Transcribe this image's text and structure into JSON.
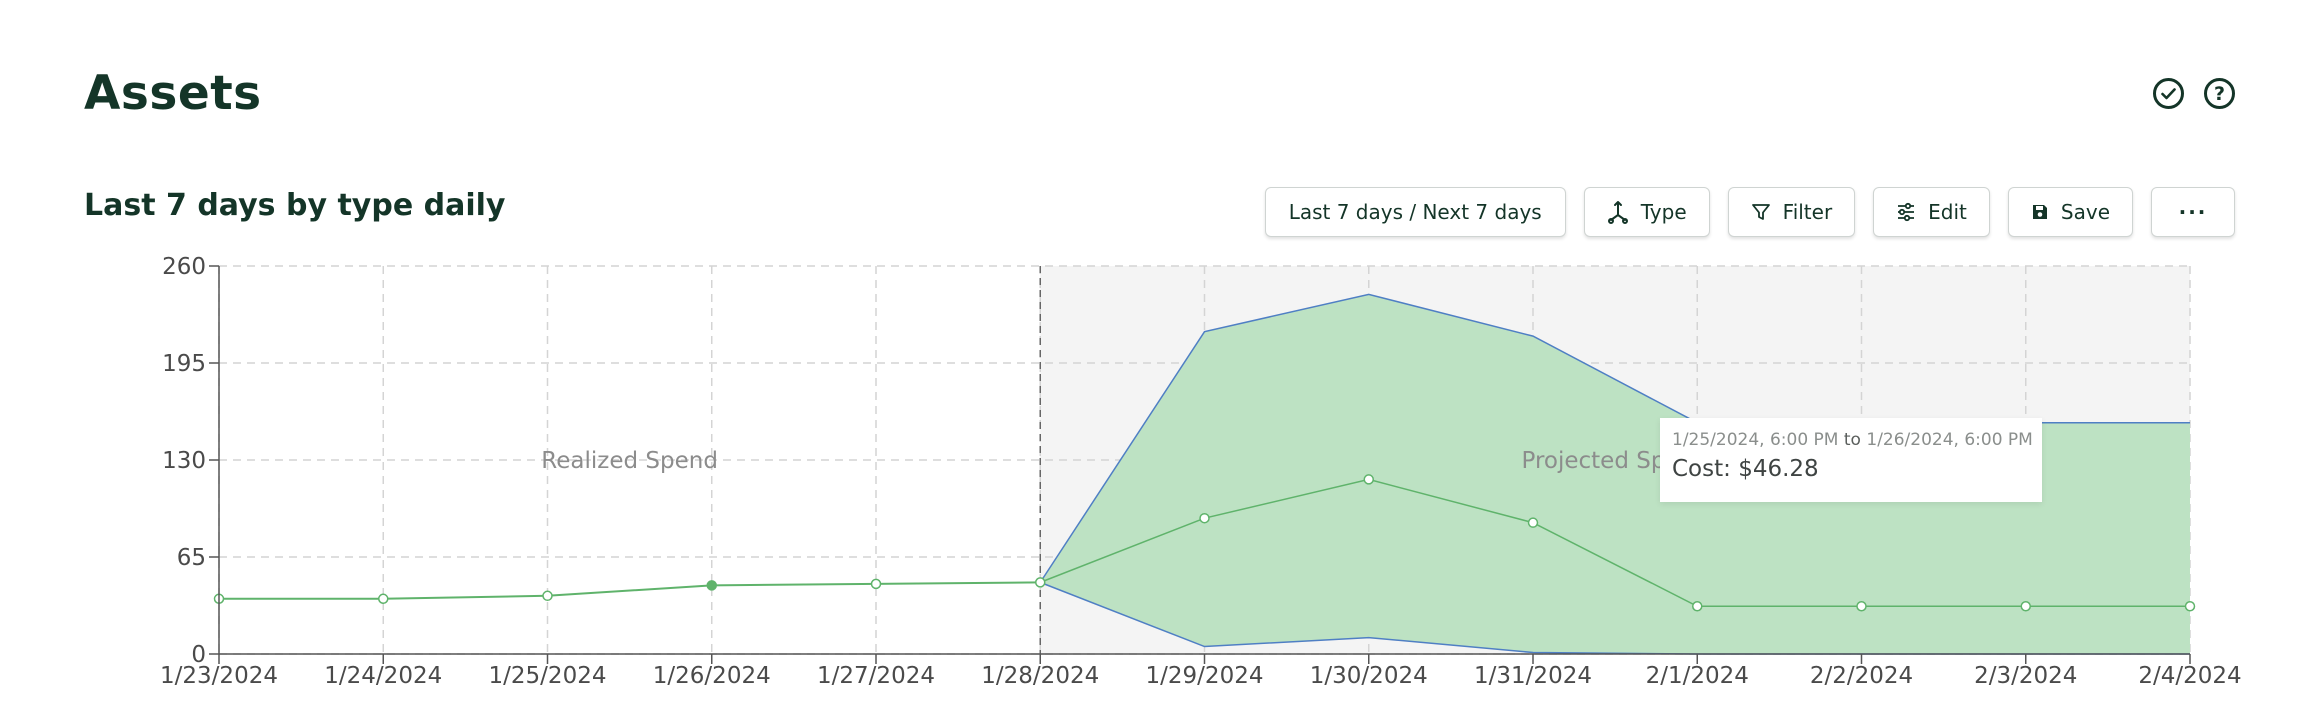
{
  "page": {
    "title": "Assets"
  },
  "header_icons": [
    {
      "name": "check-circle-icon"
    },
    {
      "name": "help-circle-icon",
      "glyph": "?"
    }
  ],
  "chart_title": "Last 7 days by type daily",
  "toolbar": {
    "range_label": "Last 7 days / Next 7 days",
    "type_label": "Type",
    "filter_label": "Filter",
    "edit_label": "Edit",
    "save_label": "Save",
    "more_label": "···"
  },
  "tooltip": {
    "range_start": "1/25/2024, 6:00 PM",
    "range_sep": "to",
    "range_end": "1/26/2024, 6:00 PM",
    "cost_label": "Cost:",
    "cost_value": "$46.28"
  },
  "chart_data": {
    "type": "line",
    "title": "Last 7 days by type daily",
    "xlabel": "",
    "ylabel": "",
    "categories": [
      "1/23/2024",
      "1/24/2024",
      "1/25/2024",
      "1/26/2024",
      "1/27/2024",
      "1/28/2024",
      "1/29/2024",
      "1/30/2024",
      "1/31/2024",
      "2/1/2024",
      "2/2/2024",
      "2/3/2024",
      "2/4/2024"
    ],
    "ylim": [
      0,
      260
    ],
    "yticks": [
      0,
      65,
      130,
      195,
      260
    ],
    "grid": true,
    "realized": {
      "label": "Realized Spend",
      "values": [
        37,
        37,
        39,
        46,
        47,
        48
      ]
    },
    "projected": {
      "label": "Projected Spend",
      "start_index": 5,
      "values": [
        48,
        91,
        117,
        88,
        32,
        32,
        32,
        32
      ],
      "upper": [
        48,
        216,
        241,
        213,
        155,
        155,
        155,
        155
      ],
      "lower": [
        48,
        5,
        11,
        1,
        0,
        0,
        0,
        0
      ]
    },
    "colors": {
      "line": "#5fb36b",
      "band_fill": "#bde2c3",
      "band_edge": "#4f7fc4",
      "projected_bg": "#f4f4f4",
      "grid": "#d4d4d4",
      "axis": "#555555",
      "tick_label": "#4a4a4a",
      "zone_label": "#8c8c8c"
    }
  }
}
